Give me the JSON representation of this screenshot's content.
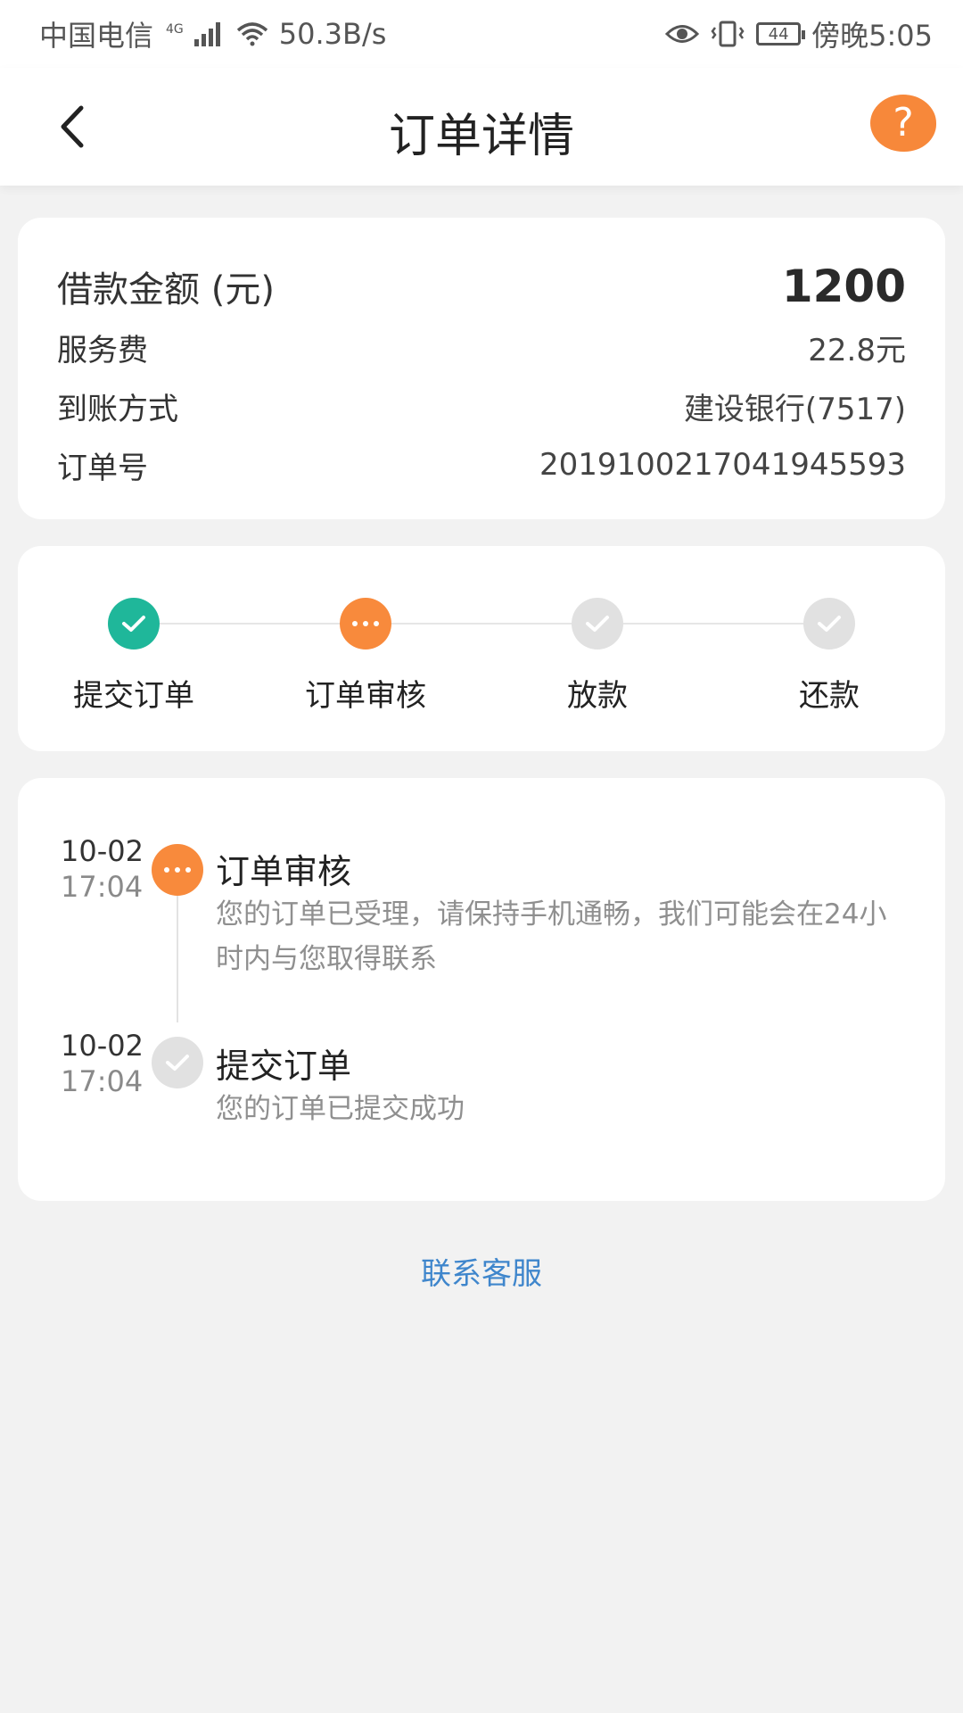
{
  "status_bar": {
    "carrier": "中国电信",
    "network": "4G",
    "speed": "50.3B/s",
    "battery": "44",
    "time": "傍晚5:05"
  },
  "nav": {
    "title": "订单详情",
    "back_icon": "chevron-left-icon",
    "help_icon": "question-bubble-icon"
  },
  "summary": {
    "amount_label": "借款金额 (元)",
    "amount_value": "1200",
    "fee_label": "服务费",
    "fee_value": "22.8元",
    "method_label": "到账方式",
    "method_value": "建设银行(7517)",
    "order_label": "订单号",
    "order_value": "2019100217041945593"
  },
  "steps": [
    {
      "label": "提交订单",
      "state": "done"
    },
    {
      "label": "订单审核",
      "state": "active"
    },
    {
      "label": "放款",
      "state": "pending"
    },
    {
      "label": "还款",
      "state": "pending"
    }
  ],
  "timeline": [
    {
      "date": "10-02",
      "time": "17:04",
      "title": "订单审核",
      "desc": "您的订单已受理，请保持手机通畅，我们可能会在24小时内与您取得联系",
      "state": "active"
    },
    {
      "date": "10-02",
      "time": "17:04",
      "title": "提交订单",
      "desc": "您的订单已提交成功",
      "state": "pending"
    }
  ],
  "contact_label": "联系客服",
  "colors": {
    "accent_orange": "#f88a3c",
    "done_green": "#1fb79a",
    "pending_gray": "#e1e1e1",
    "link_blue": "#3f86cc"
  }
}
